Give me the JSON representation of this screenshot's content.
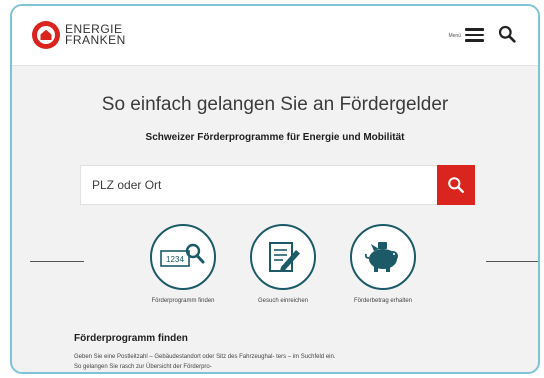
{
  "header": {
    "logo_line1": "ENERGIE",
    "logo_line2": "FRANKEN",
    "menu_label": "Menü"
  },
  "hero": {
    "title": "So einfach gelangen Sie an Fördergelder",
    "subtitle": "Schweizer Förderprogramme für Energie und Mobilität"
  },
  "search": {
    "placeholder": "PLZ oder Ort"
  },
  "steps": [
    {
      "label": "Förderprogramm finden",
      "icon": "postcode-search-icon",
      "badge": "1234"
    },
    {
      "label": "Gesuch einreichen",
      "icon": "document-edit-icon"
    },
    {
      "label": "Förderbetrag erhalten",
      "icon": "piggy-bank-icon"
    }
  ],
  "section": {
    "title": "Förderprogramm finden",
    "text": "Geben Sie eine Postleitzahl – Gebäudestandort oder Sitz des Fahrzeughal- ters – im Suchfeld ein. So gelangen Sie rasch zur Übersicht der Förderpro-"
  },
  "colors": {
    "accent": "#d9251d",
    "icon_stroke": "#1c5a68",
    "background": "#f2f2f2",
    "frame_border": "#7fc4d6"
  }
}
